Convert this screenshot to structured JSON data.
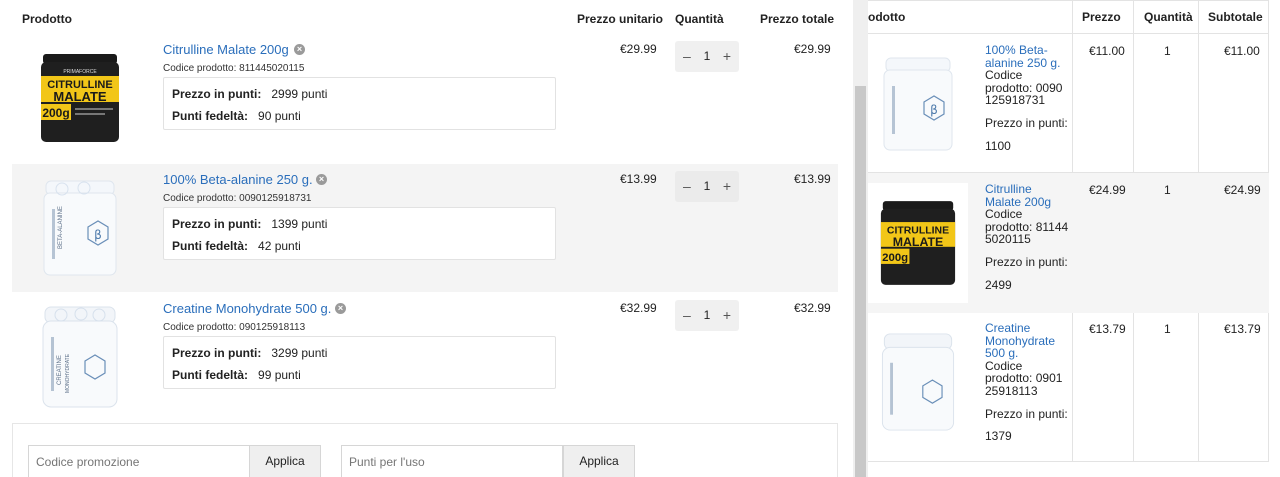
{
  "cart": {
    "headers": {
      "product": "Prodotto",
      "unit_price": "Prezzo unitario",
      "quantity": "Quantità",
      "total_price": "Prezzo totale"
    },
    "points_label": "Prezzo in punti:",
    "loyalty_label": "Punti fedeltà:",
    "items": [
      {
        "name": "Citrulline Malate 200g",
        "code": "Codice prodotto: 811445020115",
        "points_price": "2999 punti",
        "loyalty_points": "90 punti",
        "unit_price": "€29.99",
        "quantity": "1",
        "total": "€29.99",
        "image": "citrulline-malate-jar"
      },
      {
        "name": "100% Beta-alanine 250 g.",
        "code": "Codice prodotto: 0090125918731",
        "points_price": "1399 punti",
        "loyalty_points": "42 punti",
        "unit_price": "€13.99",
        "quantity": "1",
        "total": "€13.99",
        "image": "beta-alanine-jar"
      },
      {
        "name": "Creatine Monohydrate 500 g.",
        "code": "Codice prodotto: 090125918113",
        "points_price": "3299 punti",
        "loyalty_points": "99 punti",
        "unit_price": "€32.99",
        "quantity": "1",
        "total": "€32.99",
        "image": "creatine-jar"
      }
    ],
    "qty_minus": "–",
    "qty_plus": "+",
    "remove_icon": "×",
    "promo": {
      "coupon_placeholder": "Codice promozione",
      "coupon_button": "Applica",
      "points_placeholder": "Punti per l'uso",
      "points_button": "Applica"
    }
  },
  "side": {
    "headers": {
      "product": "odotto",
      "price": "Prezzo",
      "quantity": "Quantità",
      "subtotal": "Subtotale"
    },
    "code_label": "Codice prodotto:",
    "points_label": "Prezzo in punti:",
    "items": [
      {
        "name": "100% Beta-alanine 250 g.",
        "code": "0090 125918731",
        "points": "1100",
        "price": "€11.00",
        "quantity": "1",
        "subtotal": "€11.00",
        "image": "beta-alanine-jar"
      },
      {
        "name": "Citrulline Malate 200g",
        "code": "81144 5020115",
        "points": "2499",
        "price": "€24.99",
        "quantity": "1",
        "subtotal": "€24.99",
        "image": "citrulline-malate-jar"
      },
      {
        "name": "Creatine Monohydrate 500 g.",
        "code": "0901 25918113",
        "points": "1379",
        "price": "€13.79",
        "quantity": "1",
        "subtotal": "€13.79",
        "image": "creatine-jar"
      }
    ]
  },
  "colors": {
    "link": "#2a6ebb",
    "row_alt": "#f4f4f4",
    "border": "#e3e3e3"
  }
}
